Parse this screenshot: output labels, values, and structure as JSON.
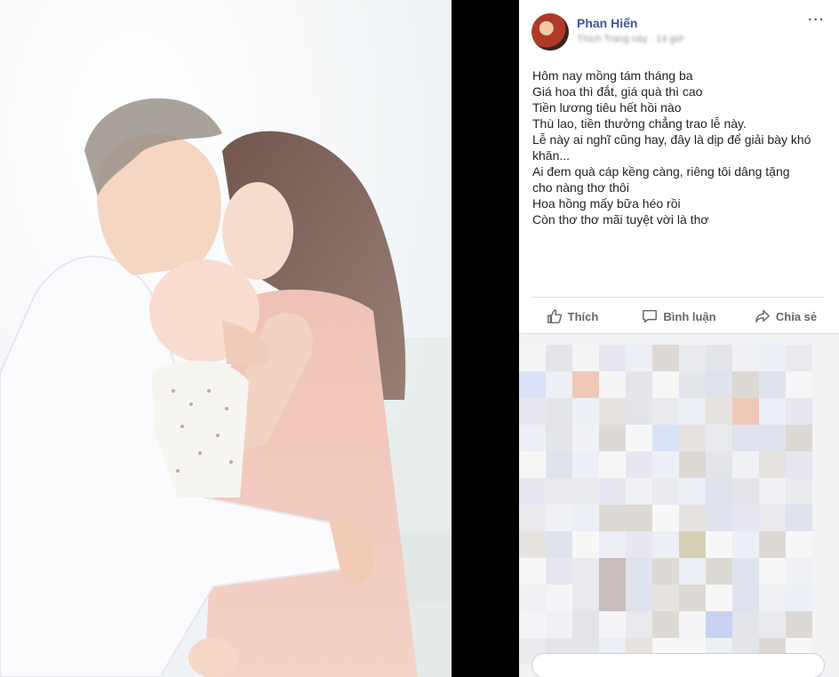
{
  "post": {
    "author": "Phan Hiển",
    "meta": "Thích Trang này · 14 giờ",
    "more_icon": "···",
    "lines": [
      "Hôm nay mồng tám tháng ba",
      "Giá hoa thì đắt, giá quà thì cao",
      "Tiền lương tiêu hết hồi nào",
      "Thù lao, tiền thưởng chẳng trao lễ này.",
      "Lễ này ai nghĩ cũng hay, đây là dịp để giải bày khó",
      "khăn...",
      "Ai đem quà cáp kềng càng, riêng tôi dâng tặng",
      "cho nàng thơ thôi",
      "Hoa hồng mấy bữa héo rồi",
      "Còn thơ thơ mãi tuyệt vời là thơ"
    ]
  },
  "actions": {
    "like": "Thích",
    "comment": "Bình luận",
    "share": "Chia sẻ"
  },
  "colors": {
    "author": "#385898",
    "action_text": "#606770",
    "body_text": "#1d2129"
  }
}
